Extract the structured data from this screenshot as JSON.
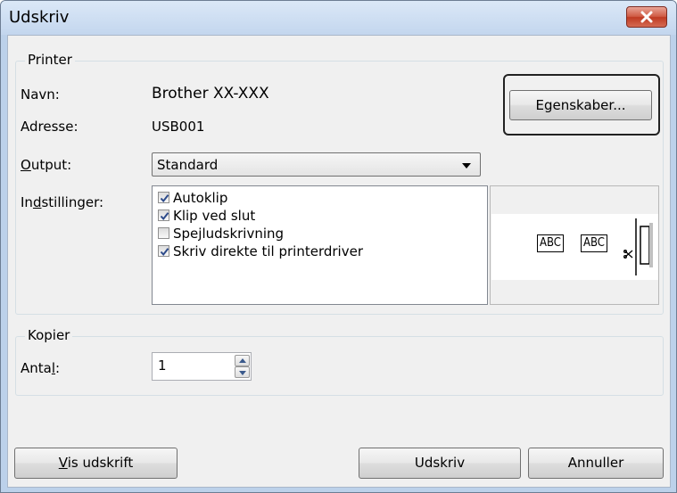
{
  "window": {
    "title": "Udskriv"
  },
  "printer_group": {
    "legend": "Printer",
    "name_label": "Navn:",
    "name_value": "Brother XX-XXX",
    "address_label": "Adresse:",
    "address_value": "USB001",
    "properties_button": "Egenskaber...",
    "output_label": "Output:",
    "output_selected": "Standard",
    "settings_label": "Indstillinger:",
    "settings": [
      {
        "label": "Autoklip",
        "checked": true
      },
      {
        "label": "Klip ved slut",
        "checked": true
      },
      {
        "label": "Spejludskrivning",
        "checked": false
      },
      {
        "label": "Skriv direkte til printerdriver",
        "checked": true
      }
    ],
    "preview": {
      "tag1": "ABC",
      "tag2": "ABC"
    }
  },
  "copies_group": {
    "legend": "Kopier",
    "count_label": "Antal:",
    "count_value": "1"
  },
  "buttons": {
    "preview": "Vis udskrift",
    "print": "Udskriv",
    "cancel": "Annuller"
  }
}
